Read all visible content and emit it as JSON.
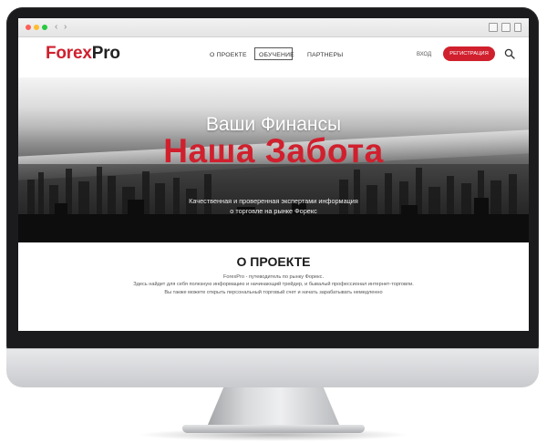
{
  "browser": {
    "traffic_lights": [
      "#ff5f57",
      "#febc2e",
      "#28c840"
    ],
    "back_icon": "chevron-left-icon",
    "forward_icon": "chevron-right-icon",
    "right_icons": [
      "share-icon",
      "tabs-icon"
    ]
  },
  "header": {
    "logo_part1": "Forex",
    "logo_part2": "Pro",
    "nav": [
      {
        "label": "О ПРОЕКТЕ",
        "active": false
      },
      {
        "label": "ОБУЧЕНИЕ",
        "active": true
      },
      {
        "label": "ПАРТНЕРЫ",
        "active": false
      }
    ],
    "login": "ВХОД",
    "register": "РЕГИСТРАЦИЯ",
    "search_icon": "search-icon"
  },
  "hero": {
    "line1": "Ваши Финансы",
    "line2": "Наша Забота",
    "sub_line1": "Качественная и проверенная экспертами информация",
    "sub_line2": "о торговле на рынке Форекс"
  },
  "about": {
    "title": "О ПРОЕКТЕ",
    "p1": "ForexPro - путеводитель по рынку Форекс.",
    "p2": "Здесь найдет для себя полезную информацию и начинающий трейдер, и бывалый профессионал интернет-торговли.",
    "p3": "Вы также можете открыть персональный торговый счет и начать зарабатывать немедленно"
  },
  "colors": {
    "accent": "#d0202e",
    "dark": "#1a1a1a"
  }
}
